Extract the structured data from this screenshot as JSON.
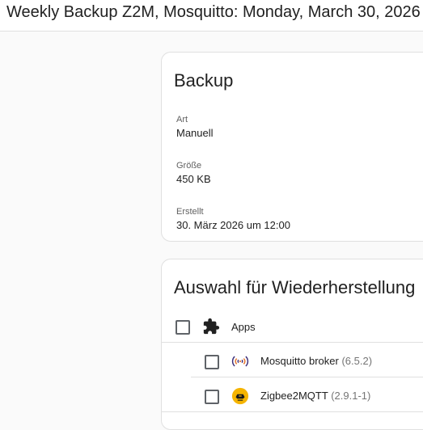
{
  "header": {
    "title": "Weekly Backup Z2M, Mosquitto: Monday, March 30, 2026"
  },
  "backup_card": {
    "title": "Backup",
    "fields": [
      {
        "label": "Art",
        "value": "Manuell"
      },
      {
        "label": "Größe",
        "value": "450 KB"
      },
      {
        "label": "Erstellt",
        "value": "30. März 2026 um 12:00"
      }
    ]
  },
  "restore_card": {
    "title": "Auswahl für Wiederherstellung",
    "items": [
      {
        "label": "Apps",
        "version": "",
        "icon": "puzzle-icon",
        "checked": false
      },
      {
        "label": "Mosquitto broker",
        "version": "(6.5.2)",
        "icon": "broadcast-icon",
        "checked": false
      },
      {
        "label": "Zigbee2MQTT",
        "version": "(2.9.1-1)",
        "icon": "zigbee2mqtt-logo-icon",
        "checked": false
      }
    ]
  },
  "colors": {
    "background": "#fafafa",
    "card": "#ffffff",
    "border": "#e0e0e0",
    "checkbox_border": "#5f6368",
    "zigbee_yellow": "#f5b400",
    "mosquitto_purple": "#3c2f7a",
    "mosquitto_orange": "#e8772e"
  }
}
